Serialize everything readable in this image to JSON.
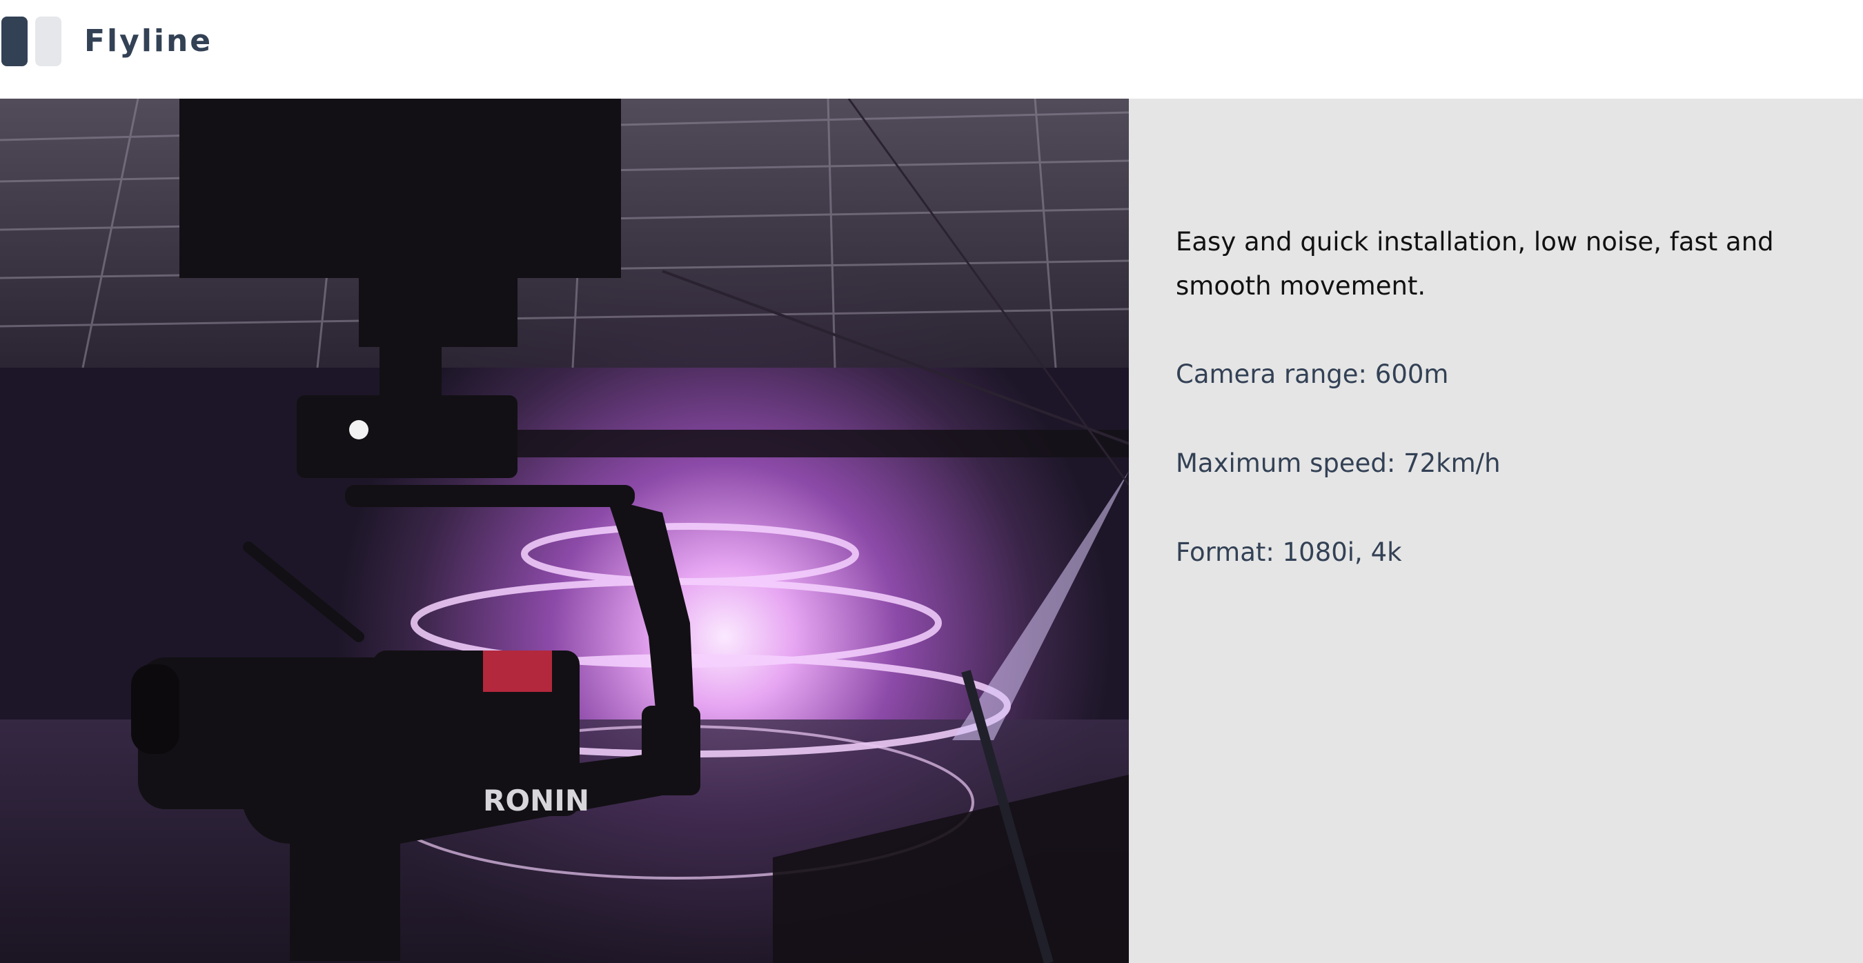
{
  "header": {
    "brand": "Flyline"
  },
  "hero_image": {
    "camera_brand_text": "RONIN"
  },
  "details": {
    "tagline": "Easy and quick installation, low noise,  fast and smooth movement.",
    "specs": [
      "Camera range: 600m",
      "Maximum speed: 72km/h",
      "Format: 1080i, 4k"
    ]
  },
  "colors": {
    "brand_text": "#334155",
    "panel_bg": "#e5e5e5",
    "swatch_dark": "#334155",
    "swatch_light": "#e5e7eb"
  }
}
